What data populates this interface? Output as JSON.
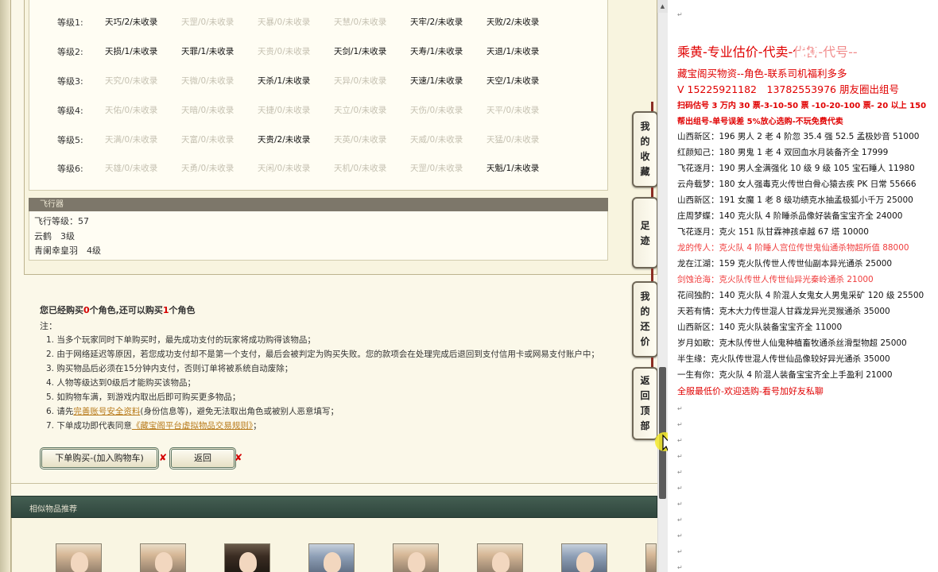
{
  "grades": [
    {
      "label": "等级1:",
      "cells": [
        {
          "text": "天巧/2/未收录",
          "dim": false
        },
        {
          "text": "天罡/0/未收录",
          "dim": true
        },
        {
          "text": "天暴/0/未收录",
          "dim": true
        },
        {
          "text": "天慧/0/未收录",
          "dim": true
        },
        {
          "text": "天牢/2/未收录",
          "dim": false
        },
        {
          "text": "天败/2/未收录",
          "dim": false
        }
      ]
    },
    {
      "label": "等级2:",
      "cells": [
        {
          "text": "天损/1/未收录",
          "dim": false
        },
        {
          "text": "天罪/1/未收录",
          "dim": false
        },
        {
          "text": "天贵/0/未收录",
          "dim": true
        },
        {
          "text": "天剑/1/未收录",
          "dim": false
        },
        {
          "text": "天寿/1/未收录",
          "dim": false
        },
        {
          "text": "天退/1/未收录",
          "dim": false
        }
      ]
    },
    {
      "label": "等级3:",
      "cells": [
        {
          "text": "天究/0/未收录",
          "dim": true
        },
        {
          "text": "天微/0/未收录",
          "dim": true
        },
        {
          "text": "天杀/1/未收录",
          "dim": false
        },
        {
          "text": "天异/0/未收录",
          "dim": true
        },
        {
          "text": "天速/1/未收录",
          "dim": false
        },
        {
          "text": "天空/1/未收录",
          "dim": false
        }
      ]
    },
    {
      "label": "等级4:",
      "cells": [
        {
          "text": "天佑/0/未收录",
          "dim": true
        },
        {
          "text": "天暗/0/未收录",
          "dim": true
        },
        {
          "text": "天捷/0/未收录",
          "dim": true
        },
        {
          "text": "天立/0/未收录",
          "dim": true
        },
        {
          "text": "天伤/0/未收录",
          "dim": true
        },
        {
          "text": "天平/0/未收录",
          "dim": true
        }
      ]
    },
    {
      "label": "等级5:",
      "cells": [
        {
          "text": "天满/0/未收录",
          "dim": true
        },
        {
          "text": "天富/0/未收录",
          "dim": true
        },
        {
          "text": "天贵/2/未收录",
          "dim": false
        },
        {
          "text": "天英/0/未收录",
          "dim": true
        },
        {
          "text": "天威/0/未收录",
          "dim": true
        },
        {
          "text": "天猛/0/未收录",
          "dim": true
        }
      ]
    },
    {
      "label": "等级6:",
      "cells": [
        {
          "text": "天雄/0/未收录",
          "dim": true
        },
        {
          "text": "天勇/0/未收录",
          "dim": true
        },
        {
          "text": "天闲/0/未收录",
          "dim": true
        },
        {
          "text": "天机/0/未收录",
          "dim": true
        },
        {
          "text": "天罡/0/未收录",
          "dim": true
        },
        {
          "text": "天魁/1/未收录",
          "dim": false
        }
      ]
    }
  ],
  "fly": {
    "header": "飞行器",
    "level": "飞行等级：57",
    "mount1": "云鹤　3级",
    "mount2": "青阑幸皇羽　4级"
  },
  "buy_status": {
    "prefix": "您已经购买",
    "bought": "0",
    "middle": "个角色,还可以购买",
    "remain": "1",
    "suffix": "个角色"
  },
  "notes": {
    "label": "注：",
    "lines": [
      "1. 当多个玩家同时下单购买时，最先成功支付的玩家将成功购得该物品；",
      "2. 由于网络延迟等原因，若您成功支付却不是第一个支付，最后会被判定为购买失败。您的款项会在处理完成后退回到支付信用卡或网易支付账户中；",
      "3. 购买物品后必须在15分钟内支付，否则订单将被系统自动废除；",
      "4. 人物等级达到0级后才能购买该物品；",
      "5. 如购物车满，到游戏内取出后即可购买更多物品；"
    ],
    "line6_a": "6. 请先",
    "line6_link": "完善账号安全资料",
    "line6_b": "(身份信息等)，避免无法取出角色或被别人恶意填写；",
    "line7_a": "7. 下单成功即代表同意",
    "line7_link": "《藏宝阁平台虚拟物品交易规则》",
    "line7_b": "；"
  },
  "buttons": {
    "buy": "下单购买-(加入购物车)",
    "back": "返回",
    "x": "✘"
  },
  "similar_title": "相似物品推荐",
  "side_tabs": [
    {
      "chars": [
        "我",
        "的",
        "收",
        "藏"
      ]
    },
    {
      "chars": [
        "足",
        "迹"
      ]
    },
    {
      "chars": [
        "我",
        "的",
        "还",
        "价"
      ]
    },
    {
      "chars": [
        "返",
        "回",
        "顶",
        "部"
      ]
    }
  ],
  "scroll_up": "▲",
  "doc": {
    "mark": "↵",
    "title": "乘黄-专业估价-代卖-代售-代号--",
    "watermark": "好看视频",
    "line2": "藏宝阁买物资--角色-联系司机福利多多",
    "line3": "V 15225921182　13782553976 朋友圈出组号",
    "line4": "扫码估号 3 万内 30 票-3-10-50 票 -10-20-100 票- 20 以上 150",
    "line5": "帮出组号-单号误差 5%放心选购-不玩免费代卖",
    "listings": [
      {
        "text": "山西新区：196 男人 2 老 4 阶忽 35.4 强 52.5 孟极妙音 51000",
        "style": ""
      },
      {
        "text": "红颜知己：180 男鬼 1 老 4 双回血水月装备齐全 17999",
        "style": ""
      },
      {
        "text": "飞花逐月：190 男人全满强化 10 级 9 级 105 宝石睡人 11980",
        "style": ""
      },
      {
        "text": "云舟载梦：180 女人强毒克火传世白骨心猿去疾 PK 日常 55666",
        "style": ""
      },
      {
        "text": "山西新区：191 女魔 1 老 8 级功绩克水抽孟极狐小千万 25000",
        "style": ""
      },
      {
        "text": "庄周梦蝶：140 克火队 4 阶睡杀品像好装备宝宝齐全 24000",
        "style": ""
      },
      {
        "text": "飞花逐月：克火 151 队甘霖神孩卓越 67 塔 10000",
        "style": ""
      },
      {
        "text": "龙的传人：克火队 4 阶睡人宫位传世鬼仙通杀物超所值 88000",
        "style": "pink"
      },
      {
        "text": "龙在江湖：159 克火队传世人传世仙副本异光通杀 25000",
        "style": ""
      },
      {
        "text": "剑蚀沧海：克火队传世人传世仙异光秦岭通杀 21000",
        "style": "pink"
      },
      {
        "text": "花间独酌：140 克火队 4 阶混人女鬼女人男鬼采矿 120 级 25500",
        "style": ""
      },
      {
        "text": "天若有情：克木大力传世混人甘霖龙异光灵猴通杀 35000",
        "style": ""
      },
      {
        "text": "山西新区：140 克火队装备宝宝齐全 11000",
        "style": ""
      },
      {
        "text": "岁月如歌：克木队传世人仙鬼种植畜牧通杀丝滑型物超 25000",
        "style": ""
      },
      {
        "text": "半生缘：克火队传世混人传世仙品像较好异光通杀 35000",
        "style": ""
      },
      {
        "text": "一生有你：克火队 4 阶混人装备宝宝齐全上手盈利 21000",
        "style": ""
      }
    ],
    "footer": "全服最低价-欢迎选购-看号加好友私聊"
  }
}
